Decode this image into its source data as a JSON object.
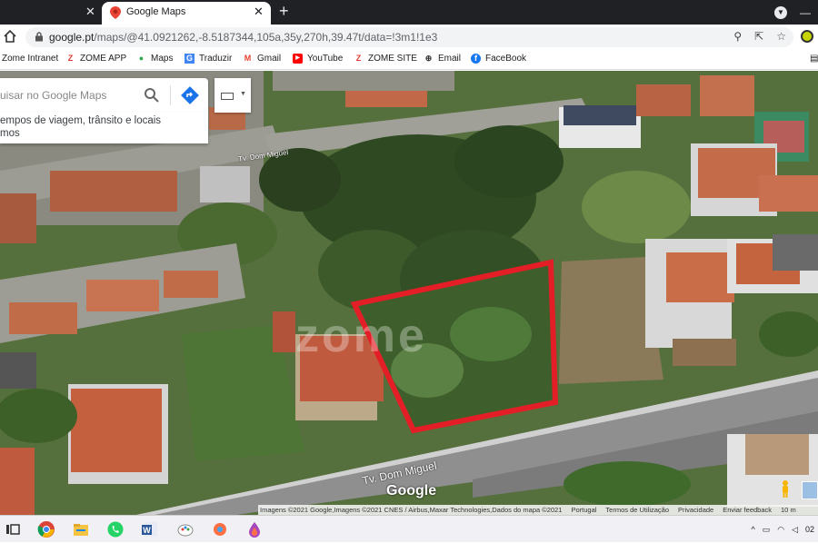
{
  "browser": {
    "tabs": [
      {
        "title": "",
        "close": "✕"
      },
      {
        "title": "Google Maps",
        "close": "✕"
      }
    ],
    "new_tab": "+",
    "url_main": "google.pt",
    "url_path": "/maps/@41.0921262,-8.5187344,105a,35y,270h,39.47t/data=!3m1!1e3",
    "bookmarks": [
      {
        "label": "Zome Intranet",
        "icon": "page-icon"
      },
      {
        "label": "ZOME APP",
        "icon": "zome-logo-icon",
        "color": "#e53935"
      },
      {
        "label": "Maps",
        "icon": "maps-pin-icon",
        "color": "#34a853"
      },
      {
        "label": "Traduzir",
        "icon": "translate-icon",
        "color": "#4285f4"
      },
      {
        "label": "Gmail",
        "icon": "gmail-icon",
        "color": "#ea4335"
      },
      {
        "label": "YouTube",
        "icon": "youtube-icon",
        "color": "#ff0000"
      },
      {
        "label": "ZOME SITE",
        "icon": "zome-logo-icon",
        "color": "#e53935"
      },
      {
        "label": "Email",
        "icon": "globe-icon",
        "color": "#333333"
      },
      {
        "label": "FaceBook",
        "icon": "facebook-icon",
        "color": "#1877f2"
      }
    ]
  },
  "maps": {
    "search_placeholder": "uisar no Google Maps",
    "suggestion_line1": "empos de viagem, trânsito e locais",
    "suggestion_line2": "mos",
    "street_top": "Tv. Dom Miguel",
    "street_bottom": "Tv. Dom Miguel",
    "watermark": "zome",
    "logo": "Google",
    "attribution": [
      "Imagens ©2021 Google,Imagens ©2021 CNES / Airbus,Maxar Technologies,Dados do mapa ©2021",
      "Portugal",
      "Termos de Utilização",
      "Privacidade",
      "Enviar feedback",
      "10 m"
    ],
    "highlight_color": "#e41e26"
  },
  "taskbar": {
    "apps": [
      "task-view-icon",
      "chrome-icon",
      "file-explorer-icon",
      "whatsapp-icon",
      "word-icon",
      "paint-icon",
      "paint-3d-icon",
      "color-drop-icon"
    ],
    "tray": [
      "^",
      "🔋",
      "📶",
      "🔊",
      "02"
    ]
  }
}
